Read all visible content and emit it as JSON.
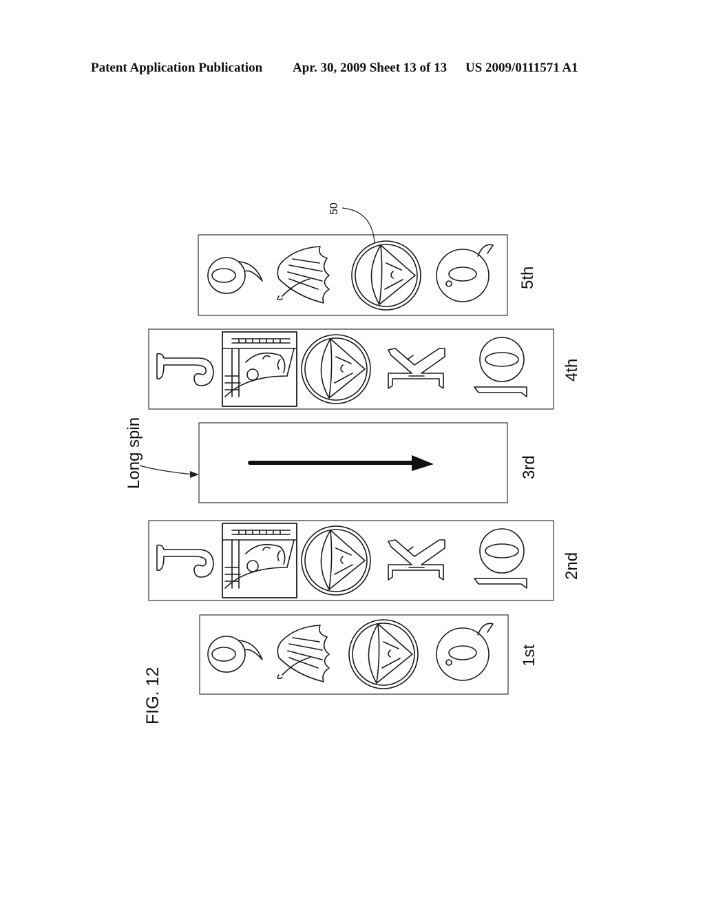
{
  "header": {
    "publication": "Patent Application Publication",
    "date_sheet": "Apr. 30, 2009  Sheet 13 of 13",
    "number": "US 2009/0111571 A1"
  },
  "figure": {
    "label": "FIG. 12",
    "reference_numeral": "50",
    "long_spin_label": "Long spin",
    "reels": [
      {
        "label": "1st",
        "symbols": [
          "9",
          "butterfly",
          "diamond-emblem",
          "Q"
        ]
      },
      {
        "label": "2nd",
        "symbols": [
          "J",
          "warrior-head",
          "diamond-emblem",
          "K",
          "10"
        ]
      },
      {
        "label": "3rd",
        "symbols": [
          "spin-arrow"
        ]
      },
      {
        "label": "4th",
        "symbols": [
          "J",
          "warrior-head",
          "diamond-emblem",
          "K",
          "10"
        ]
      },
      {
        "label": "5th",
        "symbols": [
          "9",
          "butterfly",
          "diamond-emblem",
          "Q"
        ]
      }
    ]
  }
}
